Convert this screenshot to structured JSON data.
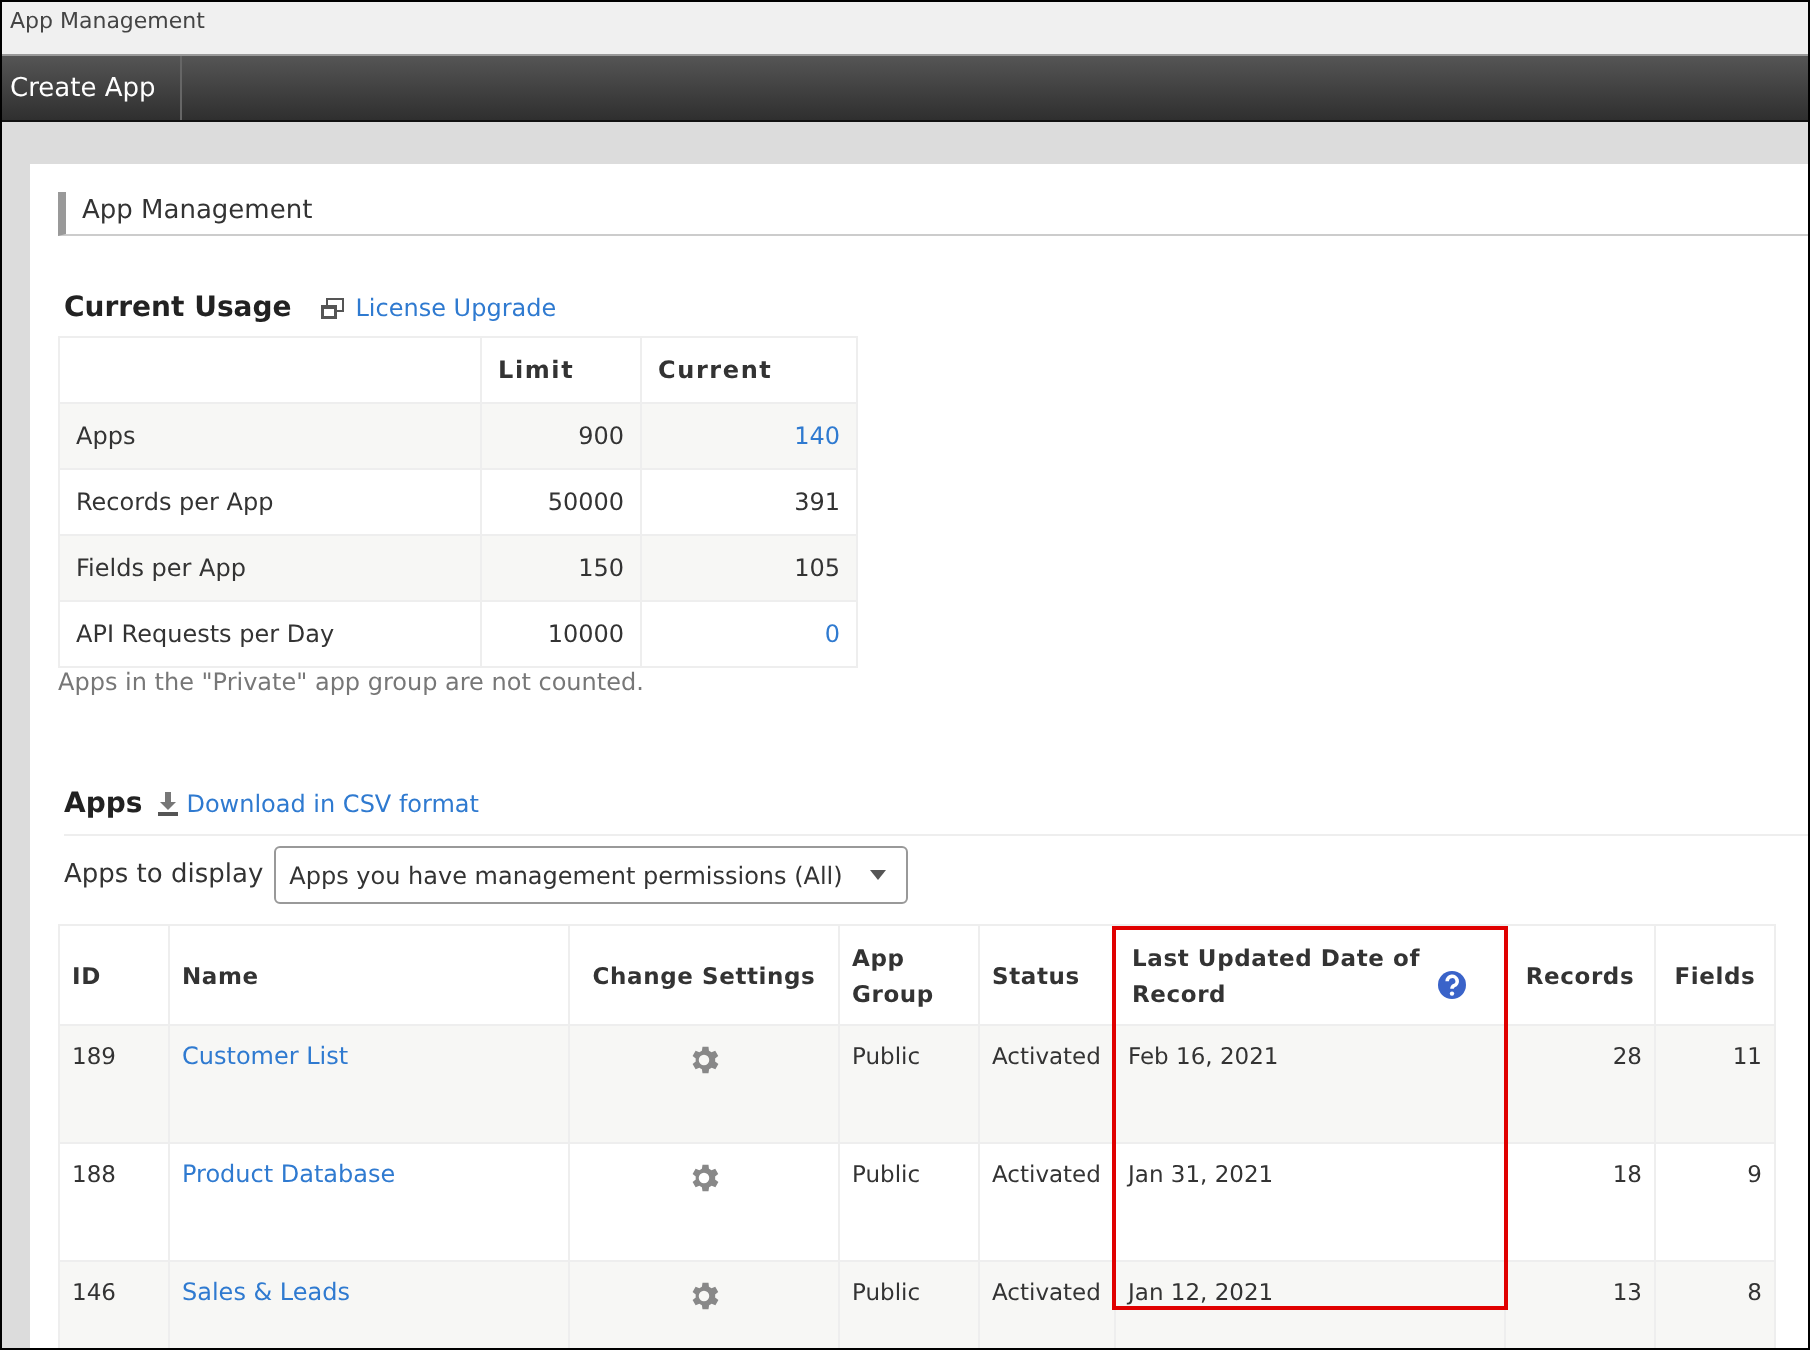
{
  "window": {
    "title": "App Management"
  },
  "toolbar": {
    "buttons": [
      "Create App"
    ]
  },
  "page": {
    "heading": "App Management"
  },
  "usage": {
    "title": "Current Usage",
    "link": "License Upgrade",
    "columns": [
      "Limit",
      "Current"
    ],
    "rows": [
      {
        "label": "Apps",
        "limit": "900",
        "current": "140",
        "current_link": true
      },
      {
        "label": "Records per App",
        "limit": "50000",
        "current": "391",
        "current_link": false
      },
      {
        "label": "Fields per App",
        "limit": "150",
        "current": "105",
        "current_link": false
      },
      {
        "label": "API Requests per Day",
        "limit": "10000",
        "current": "0",
        "current_link": true
      }
    ],
    "note": "Apps in the \"Private\" app group are not counted."
  },
  "apps": {
    "title": "Apps",
    "link": "Download in CSV format",
    "filter": {
      "label": "Apps to display",
      "value": "Apps you have management permissions (All)"
    },
    "columns": [
      {
        "label": "ID",
        "highlighted": false,
        "help": false
      },
      {
        "label": "Name",
        "highlighted": false,
        "help": false
      },
      {
        "label": "Change Settings",
        "highlighted": false,
        "help": false
      },
      {
        "label": "App Group",
        "highlighted": false,
        "help": false
      },
      {
        "label": "Status",
        "highlighted": false,
        "help": false
      },
      {
        "label": "Last Updated Date of Record",
        "highlighted": true,
        "help": true
      },
      {
        "label": "Records",
        "highlighted": false,
        "help": false
      },
      {
        "label": "Fields",
        "highlighted": false,
        "help": false
      }
    ],
    "rows": [
      {
        "id": "189",
        "name": "Customer List",
        "group": "Public",
        "status": "Activated",
        "updated": "Feb 16, 2021",
        "records": "28",
        "fields": "11"
      },
      {
        "id": "188",
        "name": "Product Database",
        "group": "Public",
        "status": "Activated",
        "updated": "Jan 31, 2021",
        "records": "18",
        "fields": "9"
      },
      {
        "id": "146",
        "name": "Sales & Leads",
        "group": "Public",
        "status": "Activated",
        "updated": "Jan 12, 2021",
        "records": "13",
        "fields": "8"
      }
    ]
  }
}
